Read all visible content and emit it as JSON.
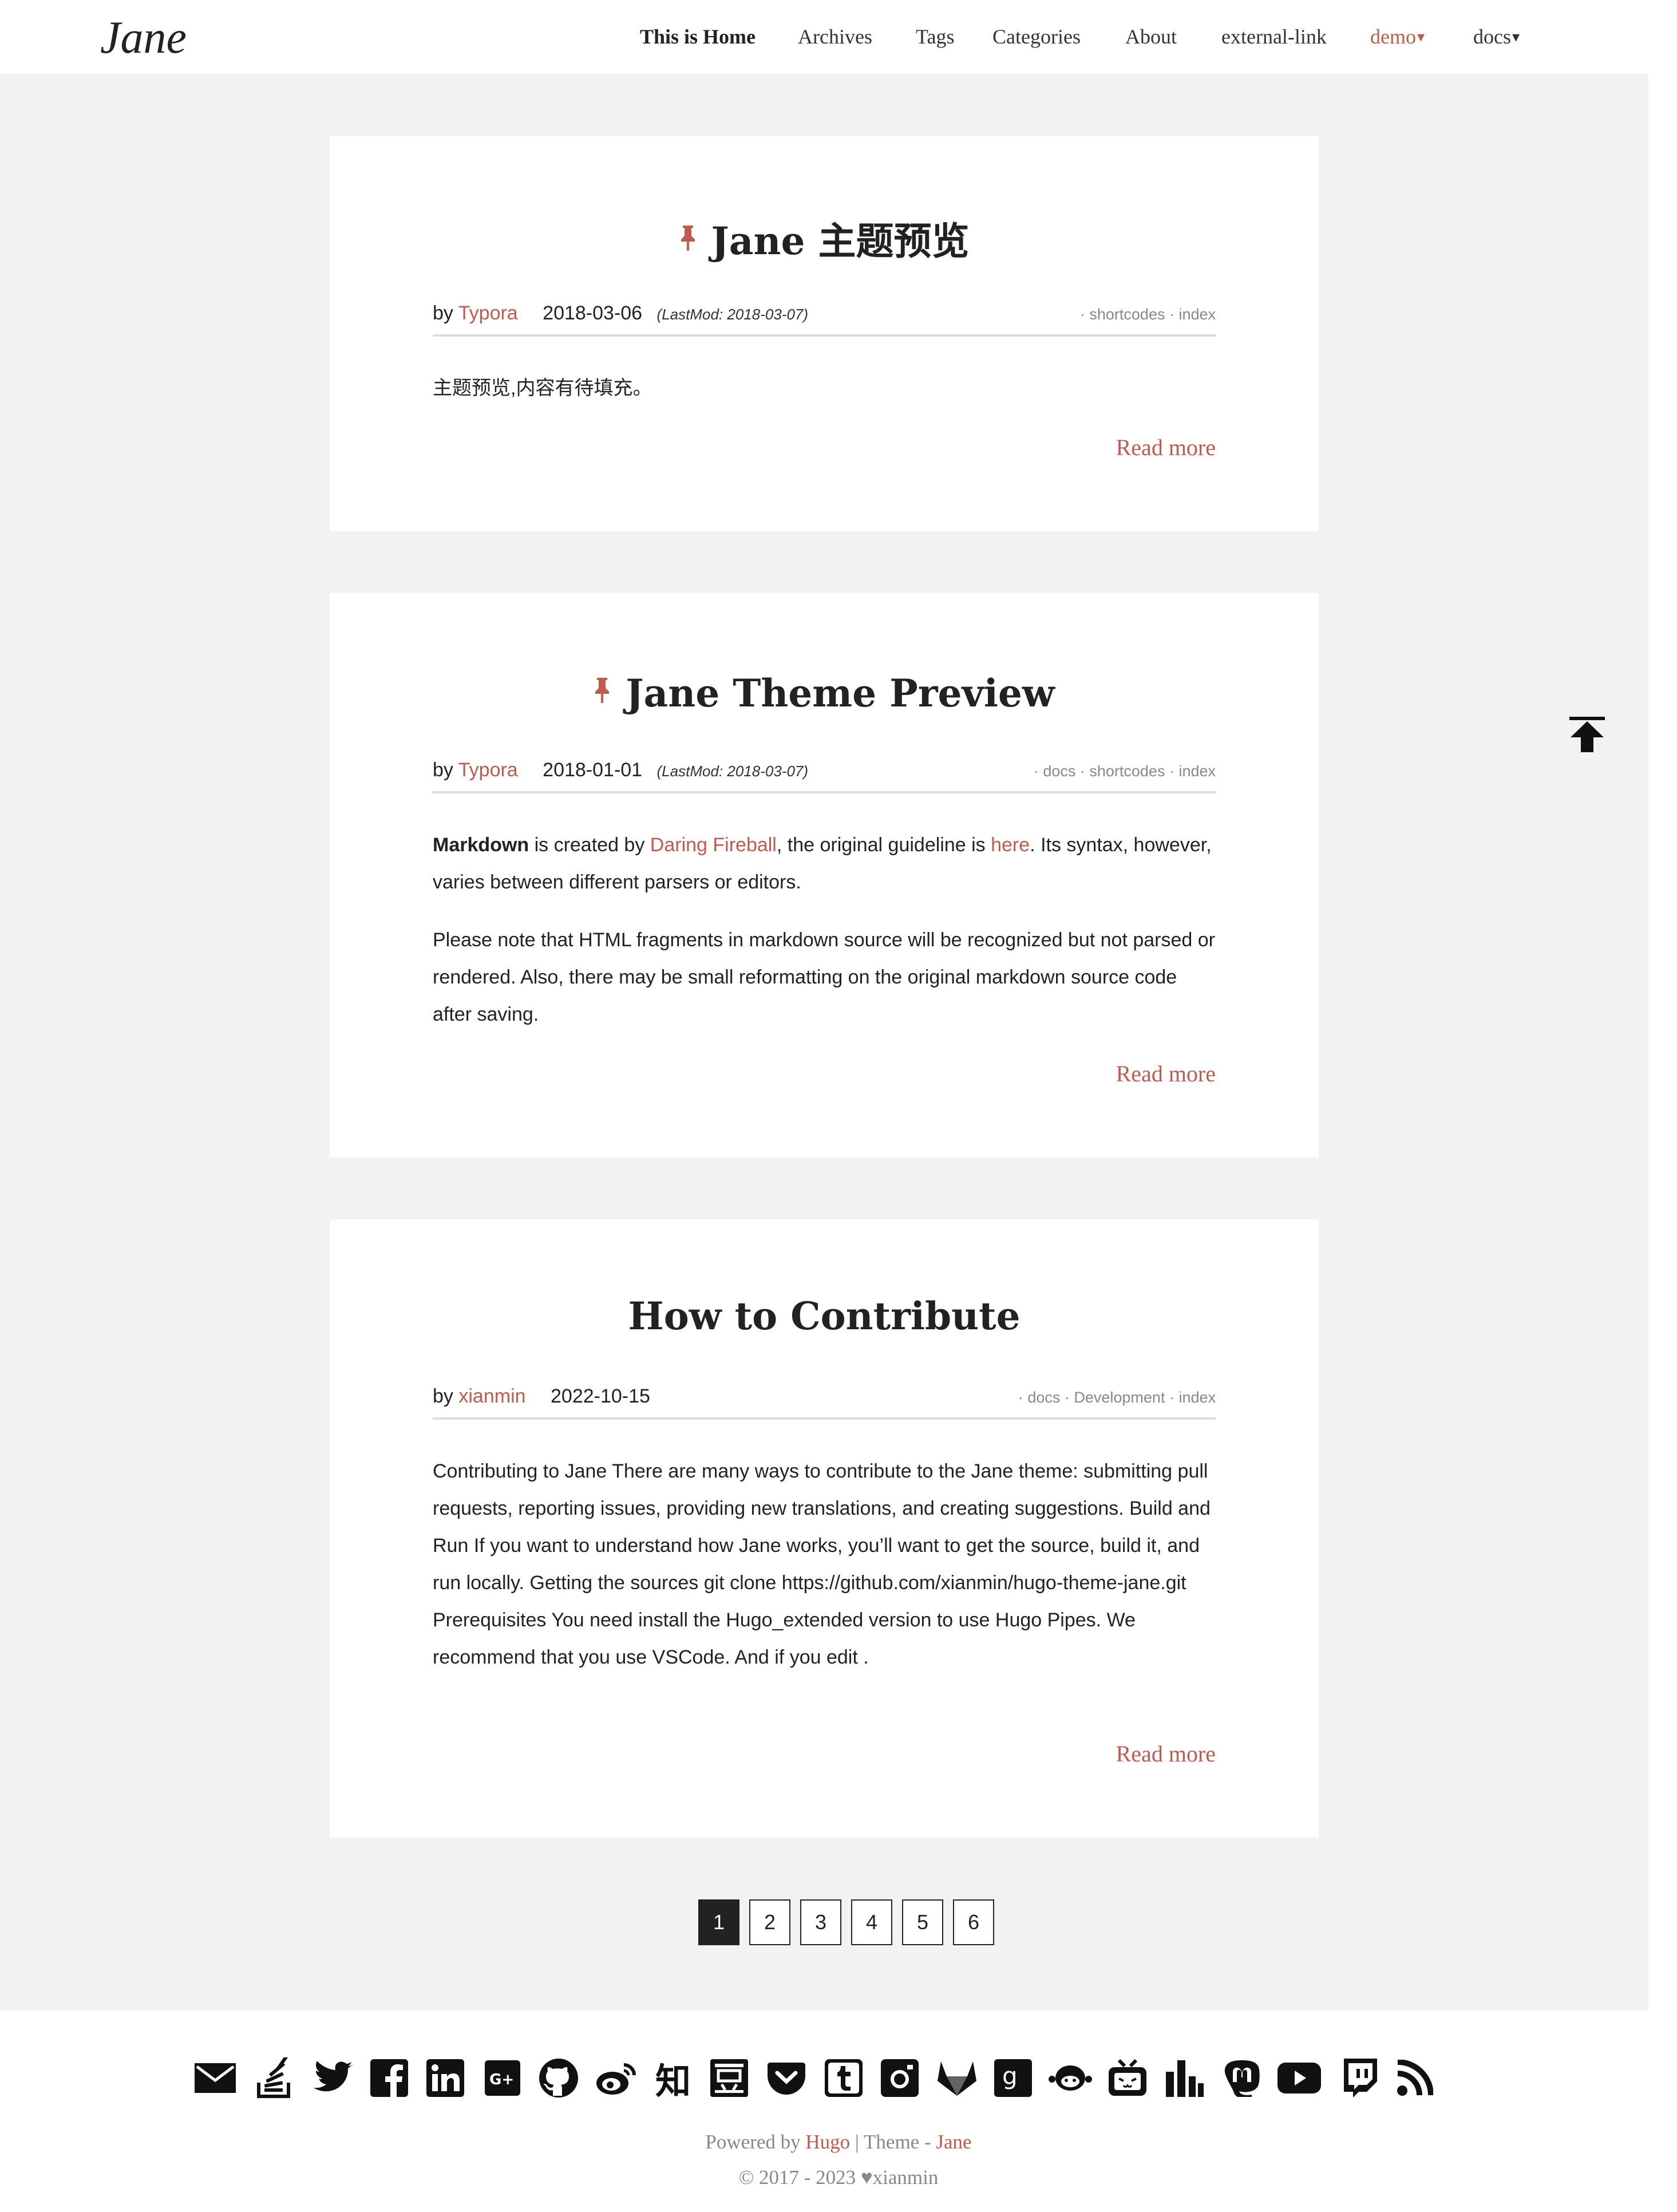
{
  "header": {
    "logo": "Jane",
    "nav": [
      {
        "label": "This is Home",
        "state": "active"
      },
      {
        "label": "Archives"
      },
      {
        "label": "Tags"
      },
      {
        "label": "Categories"
      },
      {
        "label": "About"
      },
      {
        "label": "external-link"
      },
      {
        "label": "demo",
        "caret": "▾",
        "state": "accent"
      },
      {
        "label": "docs",
        "caret": "▾"
      }
    ]
  },
  "posts": [
    {
      "pinned": true,
      "title": "Jane 主题预览",
      "by": "by",
      "author": "Typora",
      "date": "2018-03-06",
      "lastmod": "(LastMod: 2018-03-07)",
      "tags": "· shortcodes · index",
      "summary": "主题预览,内容有待填充。",
      "read_more": "Read more"
    },
    {
      "pinned": true,
      "title": "Jane Theme Preview",
      "by": "by",
      "author": "Typora",
      "date": "2018-01-01",
      "lastmod": "(LastMod: 2018-03-07)",
      "tags": "· docs · shortcodes · index",
      "p1": {
        "bold": "Markdown",
        "t1": " is created by ",
        "link1": "Daring Fireball",
        "t2": ", the original guideline is ",
        "link2": "here",
        "t3": ". Its syntax, however, varies between different parsers or editors."
      },
      "p2": "Please note that HTML fragments in markdown source will be recognized but not parsed or rendered. Also, there may be small reformatting on the original markdown source code after saving.",
      "read_more": "Read more"
    },
    {
      "pinned": false,
      "title": "How to Contribute",
      "by": "by",
      "author": "xianmin",
      "date": "2022-10-15",
      "tags": "· docs · Development · index",
      "summary": "Contributing to Jane There are many ways to contribute to the Jane theme: submitting pull requests, reporting issues, providing new translations, and creating suggestions. Build and Run If you want to understand how Jane works, you’ll want to get the source, build it, and run locally. Getting the sources git clone https://github.com/xianmin/hugo-theme-jane.git Prerequisites You need install the Hugo_extended version to use Hugo Pipes. We recommend that you use VSCode. And if you edit .",
      "read_more": "Read more"
    }
  ],
  "pagination": {
    "pages": [
      "1",
      "2",
      "3",
      "4",
      "5",
      "6"
    ],
    "current": "1"
  },
  "footer": {
    "social_icons": [
      "email-icon",
      "stack-overflow-icon",
      "twitter-icon",
      "facebook-icon",
      "linkedin-icon",
      "google-plus-icon",
      "github-icon",
      "weibo-icon",
      "zhihu-icon",
      "douban-icon",
      "pocket-icon",
      "tumblr-icon",
      "instagram-icon",
      "gitlab-icon",
      "goodreads-icon",
      "coding-icon",
      "bilibili-icon",
      "bar-chart-icon",
      "mastodon-icon",
      "youtube-icon",
      "twitch-icon",
      "rss-icon"
    ],
    "zhihu_glyph": "知",
    "douban_glyph": "豆",
    "powered_prefix": "Powered by ",
    "powered_hugo": "Hugo",
    "powered_sep": " | Theme - ",
    "powered_theme": "Jane",
    "copyright_years": "© 2017 - 2023",
    "copyright_heart": "♥",
    "copyright_owner": "xianmin"
  },
  "colors": {
    "accent": "#c05b4d",
    "background": "#f2f2f3",
    "text": "#222222"
  }
}
